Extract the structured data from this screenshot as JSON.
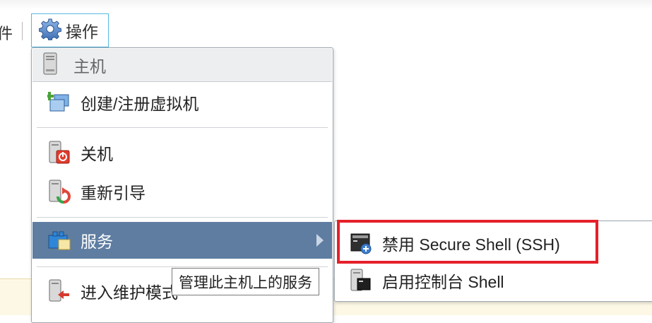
{
  "toolbar": {
    "partial_text": "件",
    "actions_label": "操作"
  },
  "menu": {
    "header_label": "主机",
    "items": [
      {
        "label": "创建/注册虚拟机",
        "icon": "create-vm-icon"
      },
      {
        "label": "关机",
        "icon": "shutdown-icon"
      },
      {
        "label": "重新引导",
        "icon": "reboot-icon"
      },
      {
        "label": "服务",
        "icon": "services-icon",
        "has_submenu": true,
        "active": true
      },
      {
        "label": "进入维护模式",
        "icon": "maintenance-icon"
      }
    ]
  },
  "submenu": {
    "items": [
      {
        "label": "禁用 Secure Shell (SSH)",
        "icon": "ssh-icon",
        "highlighted": true
      },
      {
        "label": "启用控制台 Shell",
        "icon": "console-shell-icon"
      }
    ]
  },
  "tooltip": {
    "text": "管理此主机上的服务"
  },
  "colors": {
    "active_item_bg": "#5e7da1",
    "highlight_border": "#e5202a",
    "button_border": "#55b8e2"
  }
}
